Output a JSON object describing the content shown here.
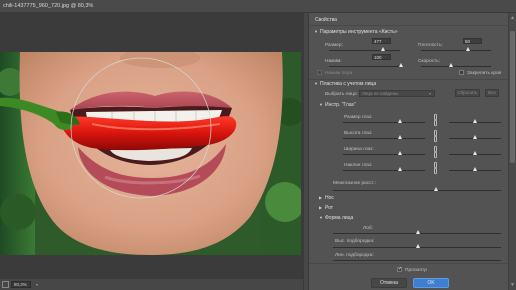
{
  "window": {
    "title": "chili-1437775_960_720.jpg @ 80,3%"
  },
  "status": {
    "zoom": "80,3%"
  },
  "panel": {
    "properties_title": "Свойства",
    "brush_section": "Параметры инструмента «Кисть»",
    "size_label": "Размер:",
    "size_value": "477",
    "density_label": "Плотность:",
    "density_value": "50",
    "pressure_label": "Нажим:",
    "pressure_value": "100",
    "rate_label": "Скорость:",
    "pin_label": "Закрепить края",
    "stylus_label": "Нажим пера",
    "face_section": "Пластика с учетом лица",
    "select_face_label": "Выбрать лицо:",
    "select_face_value": "Лица не найдены",
    "reset_button": "Сбросить",
    "all_button": "Все",
    "eyes_section": "Инстр. \"Глаз\"",
    "eye_size": "Размер глаз:",
    "eye_height": "Высота глаз:",
    "eye_width": "Ширина глаз:",
    "eye_tilt": "Наклон глаз:",
    "eye_distance": "Межглазное расст.:",
    "nose_section": "Нос",
    "mouth_section": "Рот",
    "face_shape_section": "Форма лица",
    "forehead": "Лоб:",
    "chin_height": "Выс. подбородка:",
    "jawline": "Лин. подбородка:",
    "preview_label": "Просмотр",
    "cancel_button": "Отмена",
    "ok_button": "OK"
  },
  "colors": {
    "accent": "#3f7fd0",
    "panel_bg": "#535353"
  }
}
